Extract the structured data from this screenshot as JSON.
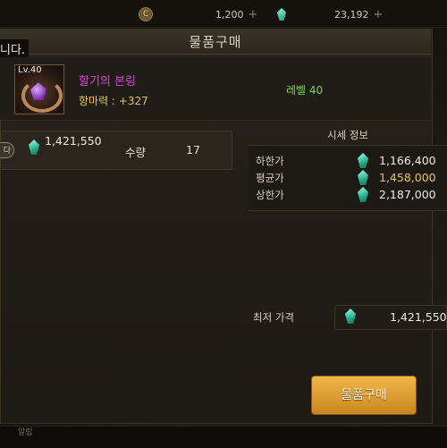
{
  "topbar": {
    "currency1": {
      "value": "1,200",
      "icon": "coin-icon"
    },
    "currency2": {
      "value": "23,192",
      "icon": "gem-icon"
    }
  },
  "dialog": {
    "title": "물품구매",
    "notice_fragment": "니다."
  },
  "item": {
    "level_badge": "Lv.40",
    "name": "할기의 본링",
    "stat": "항마력 : +327",
    "level_text": "레벨 40"
  },
  "purchase": {
    "sell_button_fragment": "다",
    "price": "1,421,550",
    "quantity_label": "수량",
    "quantity_value": "17"
  },
  "market": {
    "header": "시세 정보",
    "rows": [
      {
        "label": "하한가",
        "value": "1,166,400"
      },
      {
        "label": "평균가",
        "value": "1,458,000"
      },
      {
        "label": "상한가",
        "value": "2,187,000"
      }
    ],
    "lowest_label": "최저 가격",
    "lowest_value": "1,421,550"
  },
  "buy_button": "물품구매",
  "bottom": {
    "tab_label": "알림"
  },
  "colors": {
    "item_name": "#e040e0",
    "stat": "#e8c44c",
    "level": "#7bd84a",
    "avg_price": "#f0c23a",
    "button": "#e0a238"
  }
}
